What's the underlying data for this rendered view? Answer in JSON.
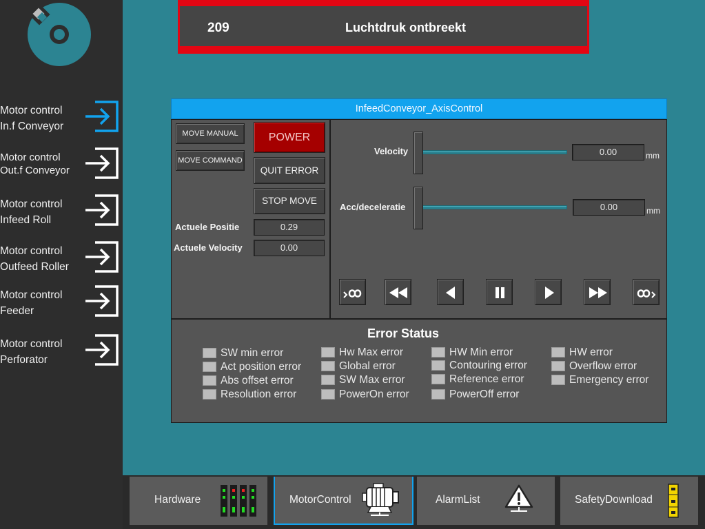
{
  "sidebar": {
    "items": [
      {
        "line1": "Motor control",
        "line2": "In.f Conveyor",
        "active": true
      },
      {
        "line1": "Motor control",
        "line2": "Out.f Conveyor",
        "active": false
      },
      {
        "line1": "Motor control",
        "line2": "Infeed Roll",
        "active": false
      },
      {
        "line1": "Motor control",
        "line2": "Outfeed Roller",
        "active": false
      },
      {
        "line1": "Motor control",
        "line2": "Feeder",
        "active": false
      },
      {
        "line1": "Motor control",
        "line2": "Perforator",
        "active": false
      }
    ]
  },
  "alarm": {
    "code": "209",
    "text": "Luchtdruk ontbreekt"
  },
  "panel": {
    "title": "InfeedConveyor_AxisControl"
  },
  "controls": {
    "move_manual": "MOVE MANUAL",
    "move_command": "MOVE COMMAND",
    "power": "POWER",
    "quit_error": "QUIT ERROR",
    "stop_move": "STOP MOVE",
    "actual_position_label": "Actuele Positie",
    "actual_position_value": "0.29",
    "actual_velocity_label": "Actuele Velocity",
    "actual_velocity_value": "0.00"
  },
  "sliders": {
    "velocity": {
      "label": "Velocity",
      "value": "0.00",
      "unit": "mm",
      "level": 0
    },
    "accel": {
      "label": "Acc/deceleratie",
      "value": "0.00",
      "unit": "mm",
      "level": 0
    }
  },
  "jog_buttons": [
    "jog-negative-infinite-icon",
    "fast-backward-icon",
    "step-backward-icon",
    "pause-icon",
    "step-forward-icon",
    "fast-forward-icon",
    "jog-positive-infinite-icon"
  ],
  "error_status": {
    "title": "Error Status",
    "columns": [
      [
        "SW min error",
        "Act position error",
        "Abs offset error",
        "Resolution error"
      ],
      [
        "Hw Max error",
        "Global error",
        "SW Max error",
        "PowerOn error"
      ],
      [
        "HW Min error",
        "Contouring error",
        "Reference error",
        "PowerOff error"
      ],
      [
        "HW error",
        "Overflow error",
        "Emergency error"
      ]
    ]
  },
  "bottom_nav": [
    {
      "label": "Hardware",
      "icon": "hardware-icon",
      "active": false
    },
    {
      "label": "MotorControl",
      "icon": "motor-icon",
      "active": true
    },
    {
      "label": "AlarmList",
      "icon": "alarm-warning-icon",
      "active": false
    },
    {
      "label": "SafetyDownload",
      "icon": "safety-download-icon",
      "active": false
    }
  ],
  "colors": {
    "accent": "#12a3ee",
    "background": "#2c8492",
    "power": "#a50000",
    "alarm": "#e30613"
  }
}
